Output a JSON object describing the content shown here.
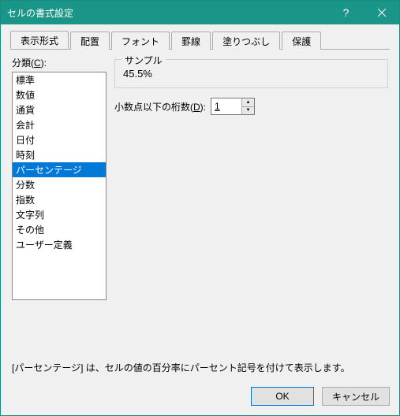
{
  "titlebar": {
    "title": "セルの書式設定"
  },
  "tabs": [
    "表示形式",
    "配置",
    "フォント",
    "罫線",
    "塗りつぶし",
    "保護"
  ],
  "active_tab_index": 0,
  "category": {
    "label_prefix": "分類(",
    "label_key": "C",
    "label_suffix": "):",
    "items": [
      "標準",
      "数値",
      "通貨",
      "会計",
      "日付",
      "時刻",
      "パーセンテージ",
      "分数",
      "指数",
      "文字列",
      "その他",
      "ユーザー定義"
    ],
    "selected_index": 6
  },
  "sample": {
    "legend": "サンプル",
    "value": "45.5%"
  },
  "decimal": {
    "label_prefix": "小数点以下の桁数(",
    "label_key": "D",
    "label_suffix": "):",
    "value": "1"
  },
  "description": "[パーセンテージ] は、セルの値の百分率にパーセント記号を付けて表示します。",
  "footer": {
    "ok": "OK",
    "cancel": "キャンセル"
  }
}
